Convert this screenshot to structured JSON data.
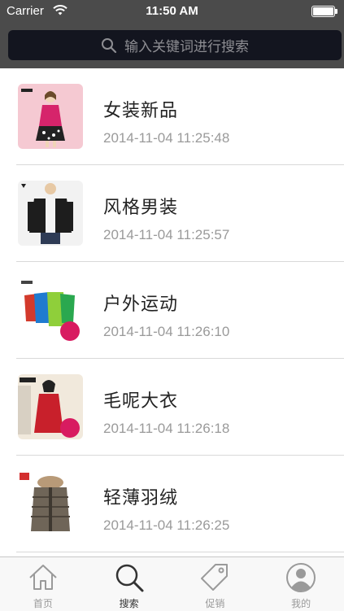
{
  "status_bar": {
    "carrier": "Carrier",
    "time": "11:50 AM"
  },
  "search": {
    "placeholder": "输入关键词进行搜索"
  },
  "items": [
    {
      "title": "女装新品",
      "date": "2014-11-04 11:25:48"
    },
    {
      "title": "风格男装",
      "date": "2014-11-04 11:25:57"
    },
    {
      "title": "户外运动",
      "date": "2014-11-04 11:26:10"
    },
    {
      "title": "毛呢大衣",
      "date": "2014-11-04 11:26:18"
    },
    {
      "title": "轻薄羽绒",
      "date": "2014-11-04 11:26:25"
    }
  ],
  "tabbar": {
    "tabs": [
      {
        "label": "首页",
        "icon": "home-icon"
      },
      {
        "label": "搜索",
        "icon": "search-icon",
        "active": true
      },
      {
        "label": "促销",
        "icon": "tag-icon"
      },
      {
        "label": "我的",
        "icon": "user-icon"
      }
    ]
  },
  "colors": {
    "header": "#4b4b4b",
    "search_field": "#13151f",
    "tabbar": "#f8f8f8"
  }
}
